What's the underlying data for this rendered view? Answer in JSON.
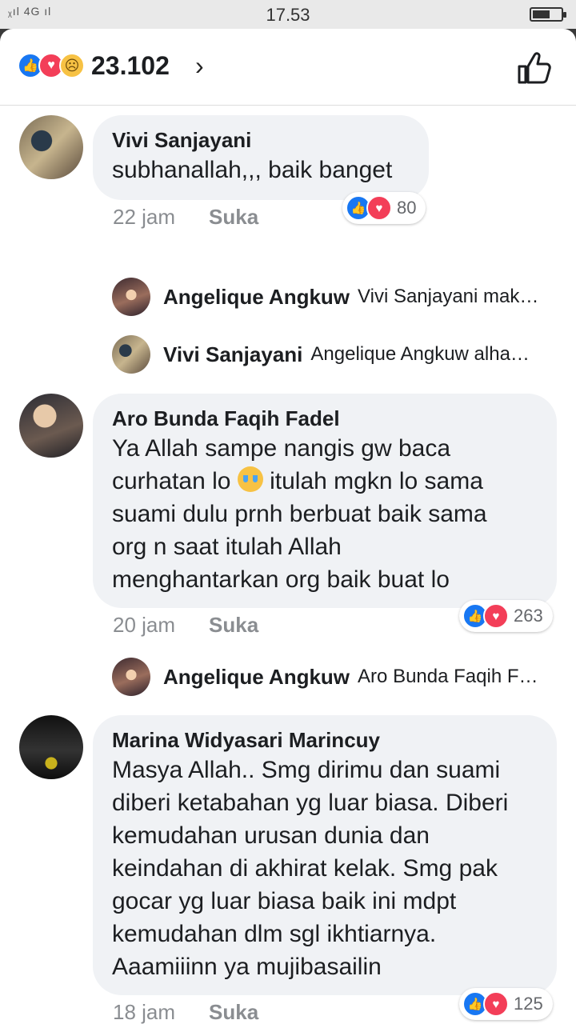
{
  "status": {
    "signal": "4G",
    "time": "17.53"
  },
  "header": {
    "reaction_count": "23.102"
  },
  "comments": [
    {
      "name": "Vivi Sanjayani",
      "text": "subhanallah,,, baik banget",
      "time": "22 jam",
      "like_label": "Suka",
      "reactions": "80"
    },
    {
      "name": "Aro Bunda Faqih Fadel",
      "text_before": "Ya Allah sampe nangis gw baca\ncurhatan lo ",
      "text_after": " itulah mgkn lo sama\nsuami dulu prnh berbuat baik sama\norg n saat itulah Allah\nmenghantarkan org baik buat lo",
      "time": "20 jam",
      "like_label": "Suka",
      "reactions": "263"
    },
    {
      "name": "Marina Widyasari Marincuy",
      "text": "Masya Allah.. Smg dirimu dan suami\ndiberi ketabahan yg luar biasa. Diberi\nkemudahan urusan dunia dan\nkeindahan di akhirat kelak. Smg pak\ngocar yg luar biasa baik ini mdpt\nkemudahan dlm sgl ikhtiarnya.\nAaamiiinn ya mujibasailin",
      "time": "18 jam",
      "like_label": "Suka",
      "reactions": "125"
    }
  ],
  "replies": [
    {
      "name": "Angelique Angkuw",
      "text": "Vivi Sanjayani mak…"
    },
    {
      "name": "Vivi Sanjayani",
      "text": "Angelique Angkuw alha…"
    },
    {
      "name": "Angelique Angkuw",
      "text": "Aro Bunda Faqih F…"
    }
  ],
  "colors": {
    "like": "#1877f2",
    "love": "#f33e58",
    "sad": "#f7c244",
    "bubble": "#f0f2f5",
    "meta": "#8a8d91"
  }
}
